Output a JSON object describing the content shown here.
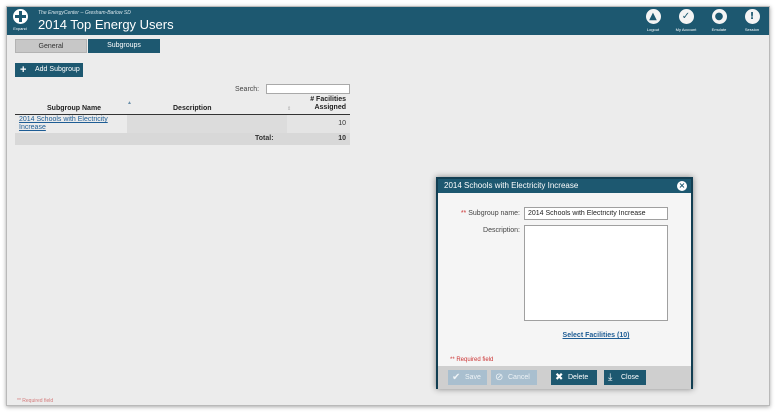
{
  "header": {
    "expand_label": "Expand",
    "organization": "The EnergyCenter -- Gresham-Barlow SD",
    "title": "2014 Top Energy Users",
    "nav": [
      {
        "label": "Logout",
        "icon": "lock-icon"
      },
      {
        "label": "My Account",
        "icon": "account-icon"
      },
      {
        "label": "Emulate",
        "icon": "users-icon"
      },
      {
        "label": "Session",
        "icon": "alert-icon"
      }
    ]
  },
  "tabs": [
    {
      "label": "General",
      "active": false
    },
    {
      "label": "Subgroups",
      "active": true
    }
  ],
  "toolbar": {
    "add_label": "Add Subgroup"
  },
  "search": {
    "label": "Search:",
    "value": ""
  },
  "table": {
    "columns": [
      "Subgroup Name",
      "Description",
      "# Facilities Assigned"
    ],
    "column_facilities_line1": "# Facilities",
    "column_facilities_line2": "Assigned",
    "rows": [
      {
        "name": "2014 Schools with Electricity Increase",
        "description": "",
        "facilities": "10"
      }
    ],
    "total_label": "Total:",
    "total_value": "10"
  },
  "footer_note": "** Required field",
  "modal": {
    "title": "2014 Schools with Electricity Increase",
    "name_label": "Subgroup name:",
    "name_required": "**",
    "name_value": "2014 Schools with Electricity Increase",
    "description_label": "Description:",
    "description_value": "",
    "select_link": "Select Facilities (10)",
    "required_note": "** Required field",
    "buttons": {
      "save": "Save",
      "cancel": "Cancel",
      "delete": "Delete",
      "close": "Close"
    }
  },
  "colors": {
    "primary": "#1d5870",
    "link": "#1d5c94",
    "required": "#cc3333",
    "disabled_button": "#a9bfcf"
  }
}
